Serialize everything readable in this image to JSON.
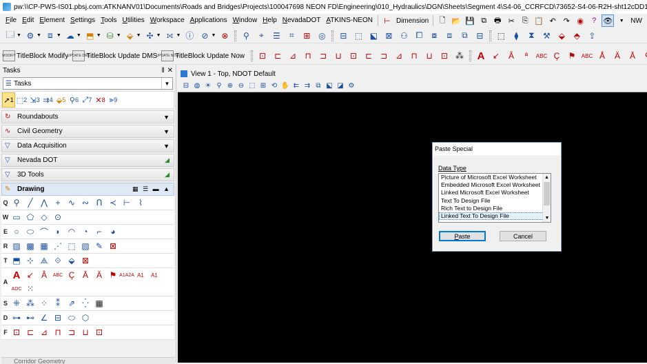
{
  "window": {
    "title": "pw:\\\\CP-PWS-IS01.pbsj.com:ATKNANV01\\Documents\\Roads and Bridges\\Projects\\100047698 NEON FD\\Engineering\\010_Hydraulics\\DGN\\Sheets\\Segment 4\\S4-06_CCRFCD\\73652-S4-06-R2H-sht12cDD14A.dgn [3D - V8 DGN] - Micro"
  },
  "menubar": {
    "items": [
      "File",
      "Edit",
      "Element",
      "Settings",
      "Tools",
      "Utilities",
      "Workspace",
      "Applications",
      "Window",
      "Help",
      "NevadaDOT",
      "ATKINS-NEON"
    ],
    "dimension_label": "Dimension",
    "nw_label": "NW"
  },
  "toolbar2": {
    "titleblock_modify": "TitleBlock Modify",
    "titleblock_update_dms": "TitleBlock Update DMS",
    "titleblock_update_now": "TitleBlock Update Now",
    "icon_text_modify": "MODIFY",
    "icon_text_update_dms": "UPDATE DMS",
    "icon_text_update_now": "UPDATE NOW"
  },
  "tasks": {
    "header": "Tasks",
    "pin": "‖",
    "close": "✕",
    "combo_value": "Tasks",
    "quick_numbers": [
      "1",
      "2",
      "3",
      "4",
      "5",
      "6",
      "7",
      "8",
      "9"
    ],
    "groups": [
      "Roundabouts",
      "Civil Geometry",
      "Data Acquisition",
      "Nevada DOT",
      "3D Tools"
    ],
    "drawing_label": "Drawing",
    "row_letters": [
      "Q",
      "W",
      "E",
      "R",
      "T",
      "A",
      "S",
      "D",
      "F"
    ],
    "bottom_group": "Corridor Geometry"
  },
  "view": {
    "title": "View 1 - Top, NDOT Default"
  },
  "dialog": {
    "title": "Paste Special",
    "group_label": "Data Type",
    "items": [
      "Picture of Microsoft Excel Worksheet",
      "Embedded Microsoft Excel Worksheet",
      "Linked Microsoft Excel Worksheet",
      "Text To Design File",
      "Rich Text to Design File",
      "Linked Text To Design File"
    ],
    "selected_index": 5,
    "paste_label": "Paste",
    "cancel_label": "Cancel"
  },
  "colors": {
    "view_background": "#000000",
    "panel_background": "#f0f0f0",
    "selection_highlight": "#e5f1fb",
    "default_button_border": "#0078d7"
  }
}
